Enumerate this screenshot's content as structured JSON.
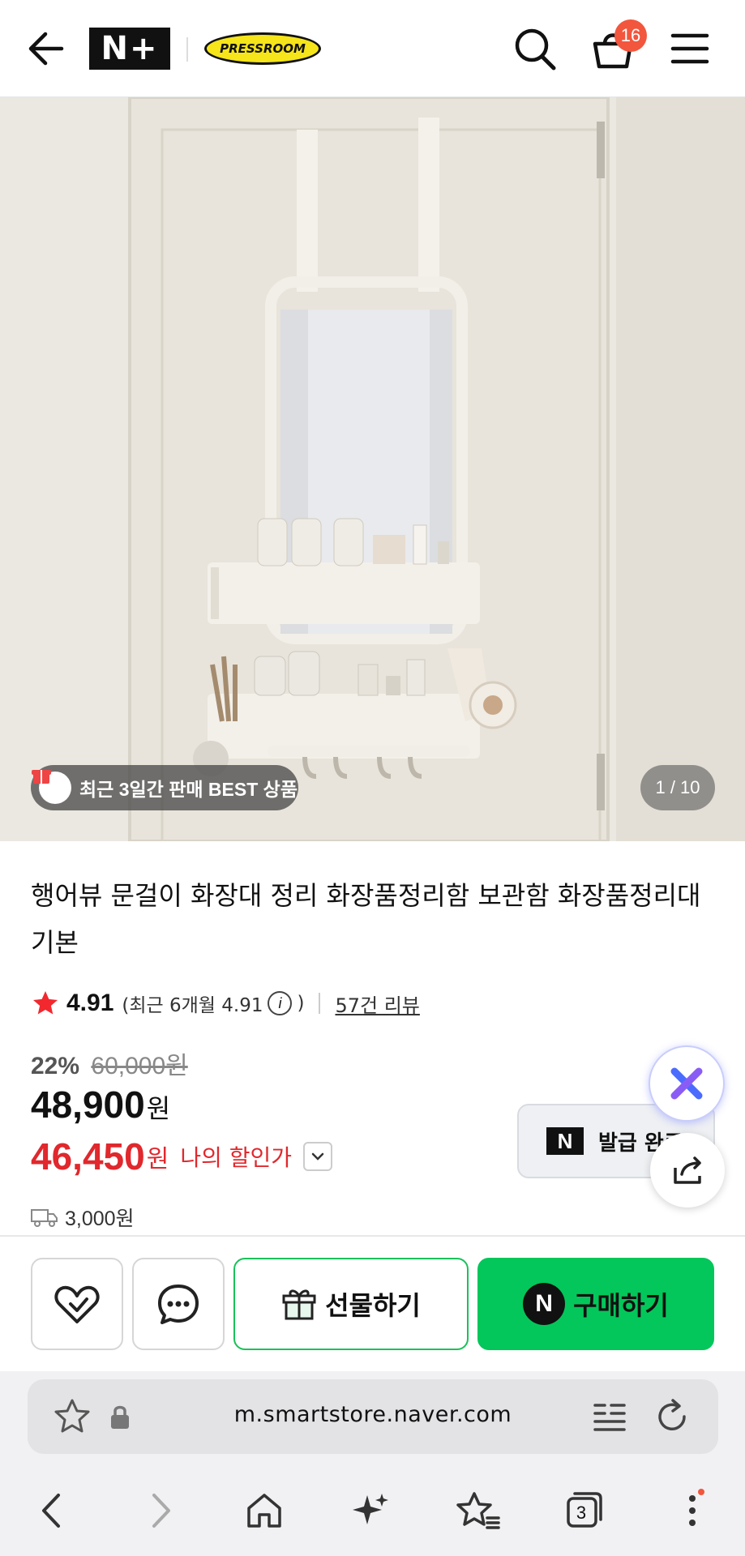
{
  "header": {
    "logo_nplus": "N+",
    "logo_brand": "PRESSROOM",
    "cart_count": "16",
    "icons": [
      "back-arrow-icon",
      "search-icon",
      "cart-icon",
      "menu-icon"
    ]
  },
  "hero": {
    "best_badge": "최근 3일간 판매 BEST 상품",
    "page_counter": "1 / 10"
  },
  "product": {
    "title": "행어뷰 문걸이 화장대 정리 화장품정리함 보관함 화장품정리대 기본",
    "rating": "4.91",
    "rating_recent": "(최근 6개월 4.91",
    "rating_recent_close": ")",
    "review_count": "57건 리뷰",
    "discount_pct": "22%",
    "original_price": "60,000원",
    "sale_price": "48,900",
    "sale_unit": "원",
    "my_price": "46,450",
    "my_price_unit": "원",
    "my_price_label": "나의 할인가",
    "shipping": "3,000원",
    "coupon_label": "발급 완료"
  },
  "actions": {
    "gift_label": "선물하기",
    "buy_label": "구매하기",
    "buy_logo": "N"
  },
  "browser": {
    "url": "m.smartstore.naver.com",
    "tab_count": "3"
  },
  "colors": {
    "naver_green": "#03c75a",
    "discount_red": "#e0282d",
    "badge_orange": "#f2563d"
  }
}
